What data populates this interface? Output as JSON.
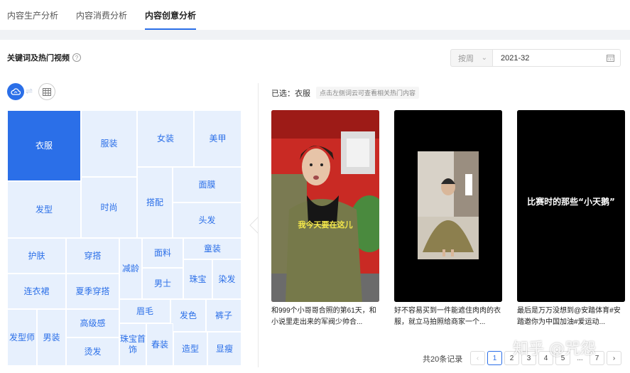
{
  "tabs": [
    {
      "label": "内容生产分析"
    },
    {
      "label": "内容消费分析"
    },
    {
      "label": "内容创意分析"
    }
  ],
  "section": {
    "title": "关键词及热门视频",
    "help": "?"
  },
  "filter": {
    "period": "按周",
    "date": "2021-32"
  },
  "treemap": {
    "selected": "衣服",
    "cells": [
      "衣服",
      "服装",
      "女装",
      "美甲",
      "发型",
      "时尚",
      "搭配",
      "面膜",
      "头发",
      "护肤",
      "穿搭",
      "减龄",
      "面料",
      "童装",
      "男士",
      "珠宝",
      "染发",
      "连衣裙",
      "夏季穿搭",
      "眉毛",
      "发色",
      "裤子",
      "高级感",
      "发型师",
      "男装",
      "珠宝首饰",
      "春装",
      "造型",
      "显瘦",
      "烫发"
    ]
  },
  "right": {
    "selected_label": "已选：",
    "selected_value": "衣服",
    "hint": "点击左侧词云可查看相关热门内容",
    "videos": [
      {
        "overlay": "我今天要在这儿",
        "title": "和999个小哥哥合照的第61天，和小说里走出来的军阀少帅合..."
      },
      {
        "overlay": "",
        "title": "好不容易买到一件能遮住肉肉的衣服，就立马拍照给商家一个..."
      },
      {
        "overlay": "比赛时的那些“小天鹅”",
        "title": "最后是万万没想到@安踏体育#安踏邀你为中国加油#爱运动..."
      }
    ]
  },
  "pagination": {
    "total": "共20条记录",
    "prev": "‹",
    "pages": [
      "1",
      "2",
      "3",
      "4",
      "5",
      "...",
      "7"
    ],
    "next": "›",
    "current": "1"
  },
  "watermark": "知乎 @咒怨",
  "colors": {
    "accent": "#2b6fe8",
    "cell": "#e7f0fd"
  }
}
